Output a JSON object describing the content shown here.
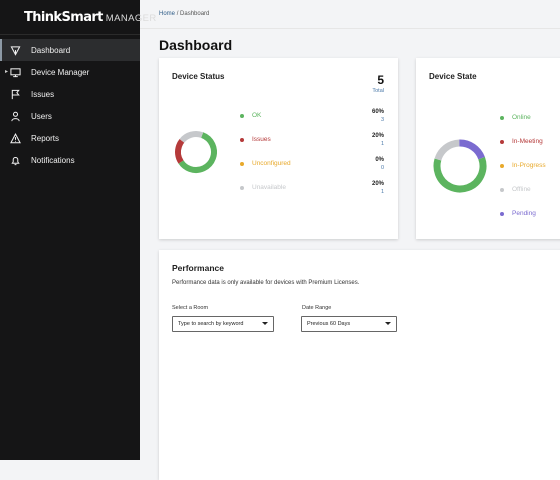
{
  "app": {
    "logo_main": "ThinkSmart",
    "logo_sub": "MANAGER"
  },
  "sidebar": {
    "items": [
      {
        "label": "Dashboard",
        "icon": "dashboard-icon",
        "active": true
      },
      {
        "label": "Device Manager",
        "icon": "monitor-icon",
        "active": false
      },
      {
        "label": "Issues",
        "icon": "flag-icon",
        "active": false
      },
      {
        "label": "Users",
        "icon": "user-icon",
        "active": false
      },
      {
        "label": "Reports",
        "icon": "warning-icon",
        "active": false
      },
      {
        "label": "Notifications",
        "icon": "bell-icon",
        "active": false
      }
    ]
  },
  "breadcrumb": {
    "home": "Home",
    "separator": "/",
    "current": "Dashboard"
  },
  "page": {
    "title": "Dashboard"
  },
  "device_status": {
    "title": "Device Status",
    "total_value": "5",
    "total_label": "Total",
    "rows": [
      {
        "label": "OK",
        "percent": "60%",
        "count": "3",
        "color": "#5cb45f"
      },
      {
        "label": "Issues",
        "percent": "20%",
        "count": "1",
        "color": "#b53a3a"
      },
      {
        "label": "Unconfigured",
        "percent": "0%",
        "count": "0",
        "color": "#e8a92b"
      },
      {
        "label": "Unavailable",
        "percent": "20%",
        "count": "1",
        "color": "#c6c8cb"
      }
    ]
  },
  "device_state": {
    "title": "Device State",
    "rows": [
      {
        "label": "Online",
        "color": "#5cb45f",
        "fraction": 0.6
      },
      {
        "label": "In-Meeting",
        "color": "#b53a3a",
        "fraction": 0.0
      },
      {
        "label": "In-Progress",
        "color": "#e8a92b",
        "fraction": 0.0
      },
      {
        "label": "Offline",
        "color": "#c6c8cb",
        "fraction": 0.2
      },
      {
        "label": "Pending",
        "color": "#7b6bd0",
        "fraction": 0.2
      }
    ]
  },
  "performance": {
    "title": "Performance",
    "description": "Performance data is only available for devices with Premium Licenses.",
    "room_label": "Select a Room",
    "room_placeholder": "Type to search by keyword",
    "date_label": "Date Range",
    "date_value": "Previous 60 Days"
  }
}
